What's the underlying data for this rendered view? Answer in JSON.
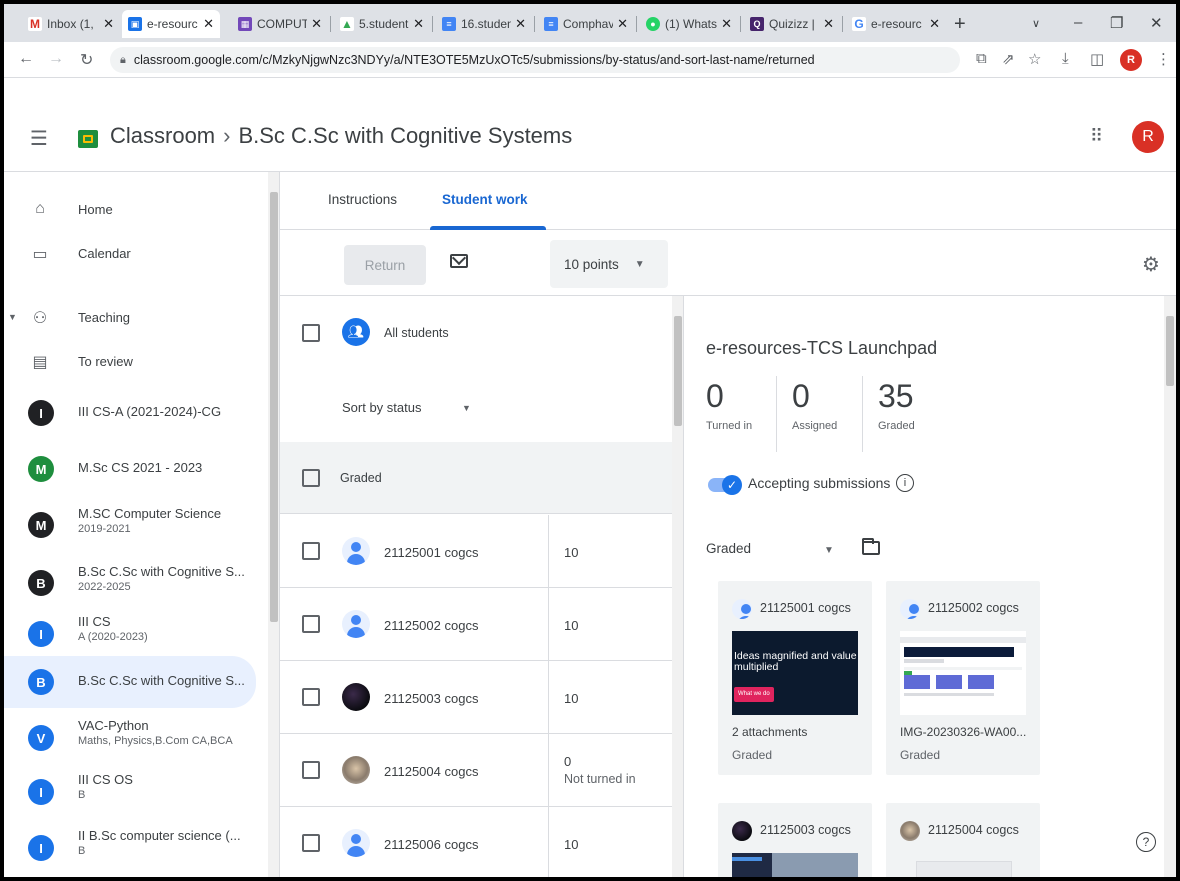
{
  "browser": {
    "tabs": [
      {
        "title": "Inbox (1,",
        "favicon": "gmail-icon",
        "color": "#d93025",
        "glyph": "M"
      },
      {
        "title": "e-resourc",
        "favicon": "classroom-icon",
        "color": "#1a73e8",
        "glyph": "▣"
      },
      {
        "title": "COMPUT",
        "favicon": "sheets-icon",
        "color": "#7248b9",
        "glyph": "▦"
      },
      {
        "title": "5.student",
        "favicon": "drive-icon",
        "color": "#34a853",
        "glyph": "▲"
      },
      {
        "title": "16.studen",
        "favicon": "docs-icon",
        "color": "#4285f4",
        "glyph": "≡"
      },
      {
        "title": "Comphav",
        "favicon": "docs-icon",
        "color": "#4285f4",
        "glyph": "≡"
      },
      {
        "title": "(1) Whats",
        "favicon": "whatsapp-icon",
        "color": "#25d366",
        "glyph": "●"
      },
      {
        "title": "Quizizz |",
        "favicon": "quizizz-icon",
        "color": "#46246b",
        "glyph": "Q"
      },
      {
        "title": "e-resourc",
        "favicon": "google-icon",
        "color": "#4285f4",
        "glyph": "G"
      }
    ],
    "url": "classroom.google.com/c/MzkyNjgwNzc3NDYy/a/NTE3OTE5MzUxOTc5/submissions/by-status/and-sort-last-name/returned",
    "profile_initial": "R"
  },
  "header": {
    "app_name": "Classroom",
    "course_name": "B.Sc C.Sc with Cognitive Systems",
    "avatar_initial": "R"
  },
  "sidebar": {
    "home": "Home",
    "calendar": "Calendar",
    "teaching": "Teaching",
    "to_review": "To review",
    "classes": [
      {
        "initial": "I",
        "name": "III CS-A (2021-2024)-CG",
        "sub": "",
        "color": "#202124"
      },
      {
        "initial": "M",
        "name": "M.Sc CS 2021 - 2023",
        "sub": "",
        "color": "#1e8e3e"
      },
      {
        "initial": "M",
        "name": "M.SC Computer Science",
        "sub": "2019-2021",
        "color": "#202124"
      },
      {
        "initial": "B",
        "name": "B.Sc C.Sc with Cognitive S...",
        "sub": "2022-2025",
        "color": "#202124"
      },
      {
        "initial": "I",
        "name": "III CS",
        "sub": "A (2020-2023)",
        "color": "#1a73e8"
      },
      {
        "initial": "B",
        "name": "B.Sc C.Sc with Cognitive S...",
        "sub": "",
        "color": "#1a73e8"
      },
      {
        "initial": "V",
        "name": "VAC-Python",
        "sub": "Maths, Physics,B.Com CA,BCA",
        "color": "#1a73e8"
      },
      {
        "initial": "I",
        "name": "III CS OS",
        "sub": "B",
        "color": "#1a73e8"
      },
      {
        "initial": "I",
        "name": "II B.Sc computer science (...",
        "sub": "B",
        "color": "#1a73e8"
      }
    ]
  },
  "tabs": {
    "instructions": "Instructions",
    "student_work": "Student work"
  },
  "actions": {
    "return": "Return",
    "points": "10 points"
  },
  "list": {
    "all_students": "All students",
    "sort": "Sort by status",
    "section": "Graded",
    "students": [
      {
        "name": "21125001 cogcs",
        "grade": "10",
        "status": "",
        "avatar": "default"
      },
      {
        "name": "21125002 cogcs",
        "grade": "10",
        "status": "",
        "avatar": "default"
      },
      {
        "name": "21125003 cogcs",
        "grade": "10",
        "status": "",
        "avatar": "dark"
      },
      {
        "name": "21125004 cogcs",
        "grade": "0",
        "status": "Not turned in",
        "avatar": "photo"
      },
      {
        "name": "21125006 cogcs",
        "grade": "10",
        "status": "",
        "avatar": "default"
      }
    ]
  },
  "detail": {
    "title": "e-resources-TCS Launchpad",
    "turned_in": "0",
    "turned_in_label": "Turned in",
    "assigned": "0",
    "assigned_label": "Assigned",
    "graded": "35",
    "graded_label": "Graded",
    "accepting": "Accepting submissions",
    "filter": "Graded",
    "cards": [
      {
        "name": "21125001 cogcs",
        "file": "2 attachments",
        "status": "Graded",
        "avatar": "default",
        "thumb_text": "Ideas magnified and value multiplied",
        "thumb_button": "What we do"
      },
      {
        "name": "21125002 cogcs",
        "file": "IMG-20230326-WA00...",
        "status": "Graded",
        "avatar": "default"
      },
      {
        "name": "21125003 cogcs",
        "file": "",
        "status": "",
        "avatar": "dark"
      },
      {
        "name": "21125004 cogcs",
        "file": "",
        "status": "",
        "avatar": "photo"
      }
    ]
  },
  "colors": {
    "accent": "#1967d2",
    "brand_green": "#1e8e3e",
    "avatar_red": "#d93025"
  }
}
